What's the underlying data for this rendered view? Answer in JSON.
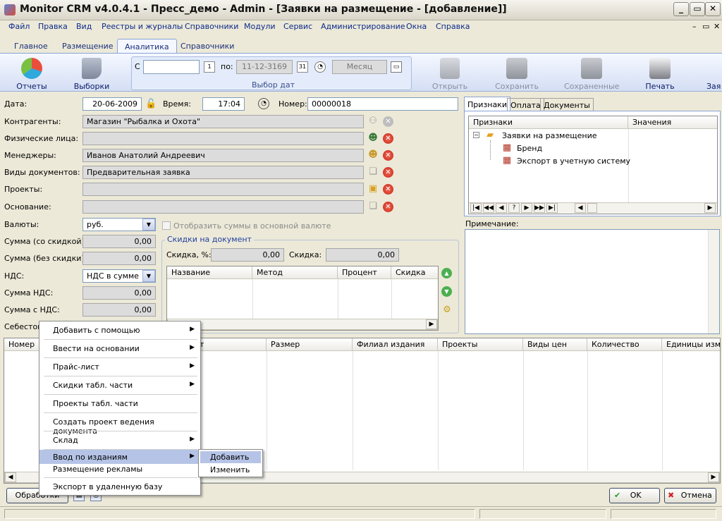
{
  "window": {
    "title": "Monitor CRM v4.0.4.1 - Пресс_демо - Admin - [Заявки на размещение - [добавление]]",
    "min": "_",
    "max": "▭",
    "close": "✕"
  },
  "menu": {
    "items": [
      "Файл",
      "Правка",
      "Вид",
      "Реестры и журналы",
      "Справочники",
      "Модули",
      "Сервис",
      "Администрирование",
      "Окна",
      "Справка"
    ],
    "mdi_min": "–",
    "mdi_restore": "▭",
    "mdi_close": "✕"
  },
  "tabs": [
    "Главное",
    "Размещение",
    "Аналитика",
    "Справочники"
  ],
  "ribbon": {
    "reports": "Отчеты",
    "selections": "Выборки",
    "from_label": "С",
    "from_value": "",
    "to_label": "по:",
    "to_value": "11-12-3169",
    "period": "Месяц",
    "group_label": "Выбор дат",
    "open": "Открыть",
    "save": "Сохранить",
    "saved": "Сохраненные",
    "print": "Печать",
    "app": "Зая"
  },
  "form": {
    "date_label": "Дата:",
    "date_value": "20-06-2009",
    "time_label": "Время:",
    "time_value": "17:04",
    "number_label": "Номер:",
    "number_value": "00000018",
    "contractors_label": "Контрагенты:",
    "contractors_value": "Магазин \"Рыбалка и Охота\"",
    "persons_label": "Физические лица:",
    "persons_value": "",
    "managers_label": "Менеджеры:",
    "managers_value": "Иванов Анатолий Андреевич",
    "doctypes_label": "Виды документов:",
    "doctypes_value": "Предварительная заявка",
    "projects_label": "Проекты:",
    "projects_value": "",
    "basis_label": "Основание:",
    "basis_value": "",
    "currency_label": "Валюты:",
    "currency_value": "руб.",
    "show_base_label": "Отобразить суммы в основной валюте",
    "sum_disc_label": "Сумма (со скидкой):",
    "sum_disc_value": "0,00",
    "sum_nodisc_label": "Сумма (без скидки):",
    "sum_nodisc_value": "0,00",
    "vat_label": "НДС:",
    "vat_value": "НДС в сумме",
    "vat_sum_label": "Сумма НДС:",
    "vat_sum_value": "0,00",
    "sum_vat_label": "Сумма с НДС:",
    "sum_vat_value": "0,00",
    "cost_label": "Себестоим"
  },
  "discounts": {
    "group_label": "Скидки на документ",
    "pct_label": "Скидка, %:",
    "pct_value": "0,00",
    "sum_label": "Скидка:",
    "sum_value": "0,00",
    "cols": [
      "Название",
      "Метод",
      "Процент",
      "Скидка"
    ]
  },
  "right_panel": {
    "tabs": [
      "Признаки",
      "Оплата",
      "Документы"
    ],
    "cols": [
      "Признаки",
      "Значения"
    ],
    "root": "Заявки на размещение",
    "children": [
      "Бренд",
      "Экспорт в учетную систему"
    ],
    "note_label": "Примечание:",
    "nav": [
      "|◀",
      "◀◀",
      "◀",
      "?",
      "▶",
      "▶▶",
      "▶|"
    ]
  },
  "main_grid": {
    "cols": [
      "Номер",
      "т",
      "Размер",
      "Филиал издания",
      "Проекты",
      "Виды цен",
      "Количество",
      "Единицы измер"
    ]
  },
  "context_menu": {
    "items": [
      "Добавить с помощью",
      "Ввести на основании",
      "Прайс-лист",
      "Скидки табл. части",
      "Проекты табл. части",
      "Создать проект ведения документа",
      "Склад",
      "Ввод по изданиям",
      "Размещение рекламы",
      "Экспорт в удаленную базу"
    ],
    "submenu": [
      "Добавить",
      "Изменить"
    ]
  },
  "bottom": {
    "process": "Обработки",
    "ok": "OK",
    "cancel": "Отмена"
  }
}
